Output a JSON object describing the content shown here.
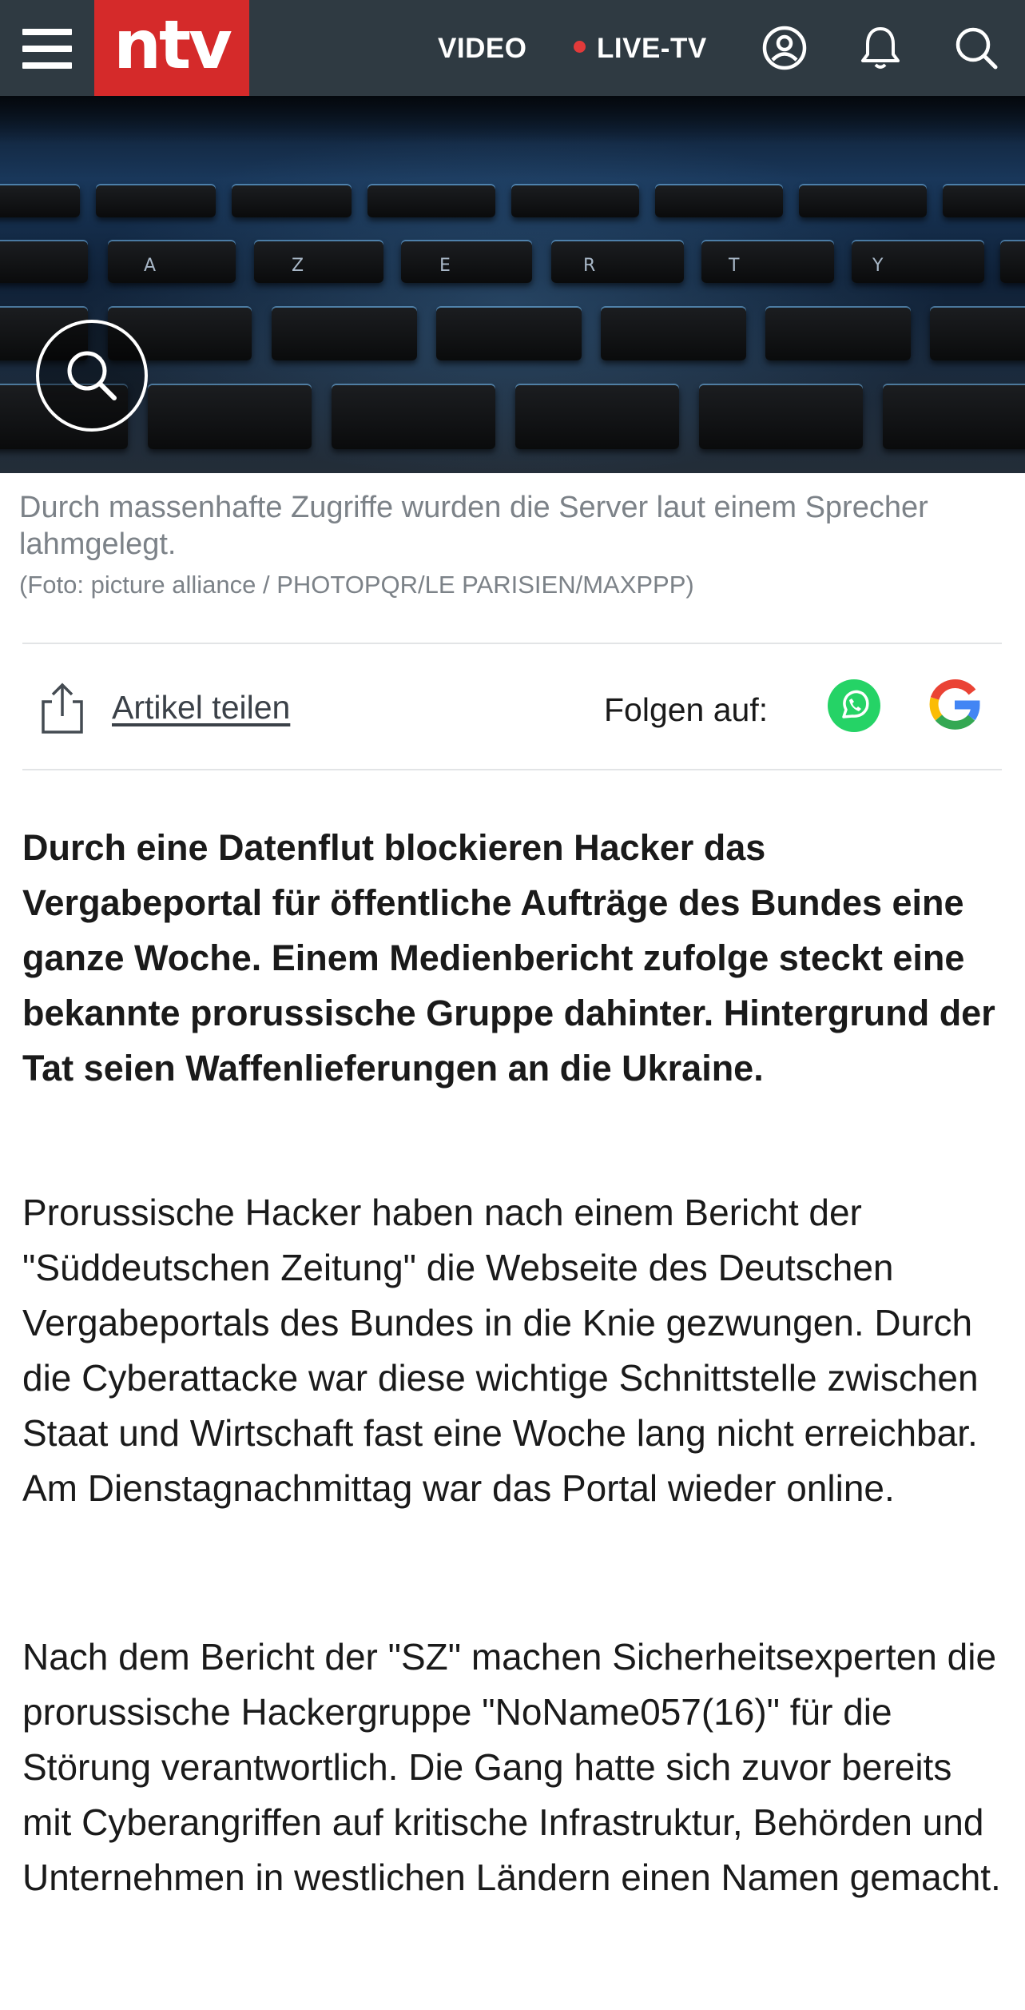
{
  "header": {
    "logo_text": "ntv",
    "nav_video": "VIDEO",
    "nav_live": "LIVE-TV",
    "brand_color": "#d52a2a",
    "background_color": "#2f3a42",
    "icons": [
      "menu-icon",
      "user-icon",
      "bell-icon",
      "search-icon"
    ]
  },
  "hero": {
    "keyboard_letters": [
      "A",
      "Z",
      "E",
      "R",
      "T",
      "Y"
    ],
    "zoom_icon": "zoom-icon"
  },
  "caption": {
    "text": "Durch massenhafte Zugriffe wurden die Server laut einem Sprecher lahmgelegt.",
    "credit": "(Foto: picture alliance / PHOTOPQR/LE PARISIEN/MAXPPP)"
  },
  "share": {
    "share_label": "Artikel teilen",
    "follow_label": "Folgen auf:",
    "whatsapp_color": "#25d366",
    "google_colors": [
      "#4285f4",
      "#ea4335",
      "#fbbc05",
      "#34a853"
    ]
  },
  "article": {
    "lead": "Durch eine Datenflut blockieren Hacker das Vergabeportal für öffentliche Aufträge des Bundes eine ganze Woche. Einem Medienbericht zufolge steckt eine bekannte prorussische Gruppe dahinter. Hintergrund der Tat seien Waffenlieferungen an die Ukraine.",
    "paragraphs": [
      "Prorussische Hacker haben nach einem Bericht der \"Süddeutschen Zeitung\" die Webseite des Deutschen Vergabeportals des Bundes in die Knie gezwungen. Durch die Cyberattacke war diese wichtige Schnittstelle zwischen Staat und Wirtschaft fast eine Woche lang nicht erreichbar. Am Dienstagnachmittag war das Portal wieder online.",
      "Nach dem Bericht der \"SZ\" machen Sicherheitsexperten die prorussische Hackergruppe \"NoName057(16)\" für die Störung verantwortlich. Die Gang hatte sich zuvor bereits mit Cyberangriffen auf kritische Infrastruktur, Behörden und Unternehmen in westlichen Ländern einen Namen gemacht."
    ]
  }
}
